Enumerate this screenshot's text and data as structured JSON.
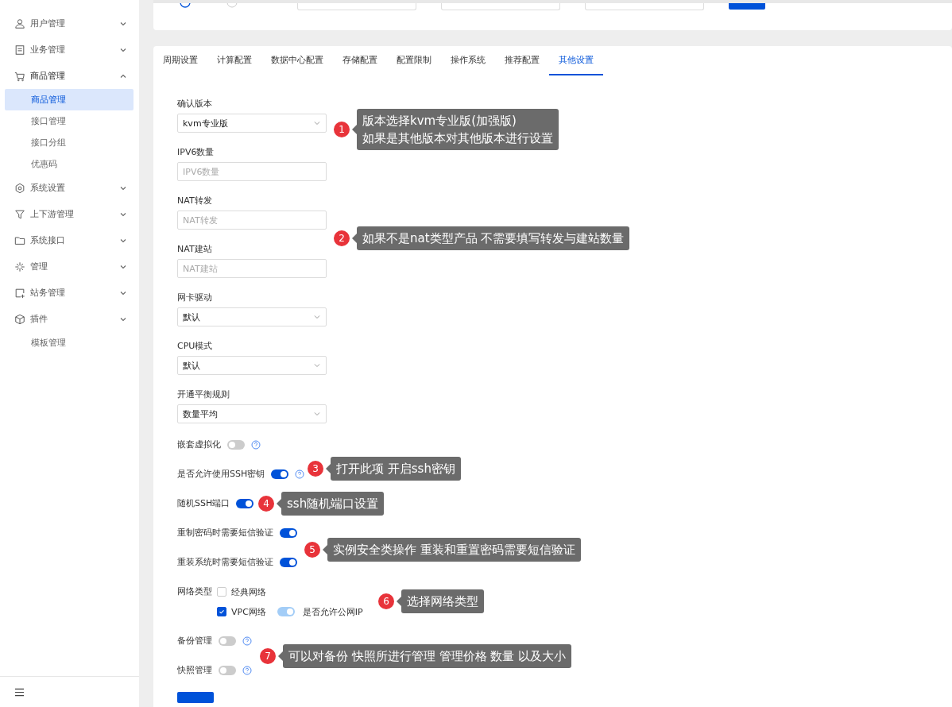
{
  "filter_bar": {
    "radios": [
      {
        "selected": true
      },
      {
        "selected": false
      }
    ]
  },
  "sidebar": {
    "items": [
      {
        "kind": "group",
        "label": "用户管理",
        "expanded": false
      },
      {
        "kind": "group",
        "label": "业务管理",
        "expanded": false
      },
      {
        "kind": "group",
        "label": "商品管理",
        "expanded": true,
        "children": [
          {
            "label": "商品管理",
            "selected": true
          },
          {
            "label": "接口管理",
            "selected": false
          },
          {
            "label": "接口分组",
            "selected": false
          },
          {
            "label": "优惠码",
            "selected": false
          }
        ]
      },
      {
        "kind": "group",
        "label": "系统设置",
        "expanded": false
      },
      {
        "kind": "group",
        "label": "上下游管理",
        "expanded": false
      },
      {
        "kind": "group",
        "label": "系统接口",
        "expanded": false
      },
      {
        "kind": "group",
        "label": "管理",
        "expanded": false
      },
      {
        "kind": "group",
        "label": "站务管理",
        "expanded": false
      },
      {
        "kind": "group",
        "label": "插件",
        "expanded": false
      },
      {
        "kind": "link",
        "label": "模板管理",
        "selected": false
      }
    ]
  },
  "tabs": [
    {
      "label": "周期设置",
      "selected": false
    },
    {
      "label": "计算配置",
      "selected": false
    },
    {
      "label": "数据中心配置",
      "selected": false
    },
    {
      "label": "存储配置",
      "selected": false
    },
    {
      "label": "配置限制",
      "selected": false
    },
    {
      "label": "操作系统",
      "selected": false
    },
    {
      "label": "推荐配置",
      "selected": false
    },
    {
      "label": "其他设置",
      "selected": true
    }
  ],
  "form": [
    {
      "kind": "select",
      "label": "确认版本",
      "value": "kvm专业版"
    },
    {
      "kind": "input",
      "label": "IPV6数量",
      "placeholder": "IPV6数量"
    },
    {
      "kind": "input",
      "label": "NAT转发",
      "placeholder": "NAT转发"
    },
    {
      "kind": "input",
      "label": "NAT建站",
      "placeholder": "NAT建站"
    },
    {
      "kind": "select",
      "label": "网卡驱动",
      "value": "默认"
    },
    {
      "kind": "select",
      "label": "CPU模式",
      "value": "默认"
    },
    {
      "kind": "select",
      "label": "开通平衡规则",
      "value": "数量平均"
    },
    {
      "kind": "switch",
      "label": "嵌套虚拟化",
      "on": false,
      "help": true
    },
    {
      "kind": "switch",
      "label": "是否允许使用SSH密钥",
      "on": true,
      "help": true
    },
    {
      "kind": "switch",
      "label": "随机SSH端口",
      "on": true,
      "help": false
    },
    {
      "kind": "switch",
      "label": "重制密码时需要短信验证",
      "on": true,
      "help": false
    },
    {
      "kind": "switch",
      "label": "重装系统时需要短信验证",
      "on": true,
      "help": false
    },
    {
      "kind": "network",
      "label": "网络类型",
      "options": [
        {
          "label": "经典网络",
          "checked": false
        },
        {
          "label": "VPC网络",
          "checked": true,
          "public_ip": {
            "label": "是否允许公网IP",
            "on": true,
            "disabled": true
          }
        }
      ]
    },
    {
      "kind": "switch",
      "label": "备份管理",
      "on": false,
      "help": true
    },
    {
      "kind": "switch",
      "label": "快照管理",
      "on": false,
      "help": true
    }
  ],
  "callouts": [
    {
      "number": "1",
      "lines": [
        "版本选择kvm专业版(加强版)",
        "如果是其他版本对其他版本进行设置"
      ]
    },
    {
      "number": "2",
      "lines": [
        "如果不是nat类型产品 不需要填写转发与建站数量"
      ]
    },
    {
      "number": "3",
      "lines": [
        "打开此项 开启ssh密钥"
      ]
    },
    {
      "number": "4",
      "lines": [
        "ssh随机端口设置"
      ]
    },
    {
      "number": "5",
      "lines": [
        "实例安全类操作  重装和重置密码需要短信验证"
      ]
    },
    {
      "number": "6",
      "lines": [
        "选择网络类型"
      ]
    },
    {
      "number": "7",
      "lines": [
        "可以对备份 快照所进行管理 管理价格 数量 以及大小"
      ]
    }
  ]
}
